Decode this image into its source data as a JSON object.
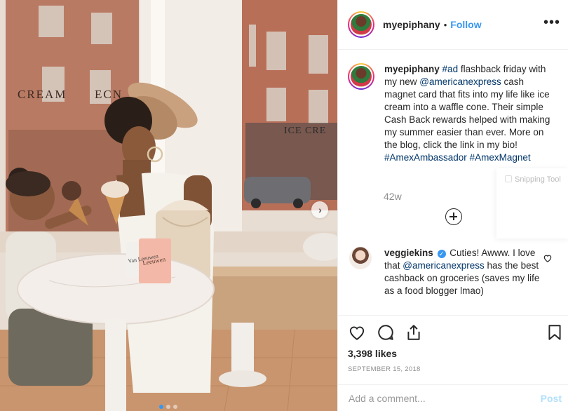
{
  "post": {
    "username": "myepiphany",
    "separator": "•",
    "follow_label": "Follow",
    "more_label": "•••",
    "caption": {
      "username": "myepiphany",
      "segments": [
        {
          "text": "#ad",
          "tag": true
        },
        {
          "text": " flashback friday with my new ",
          "tag": false
        },
        {
          "text": "@americanexpress",
          "tag": true
        },
        {
          "text": " cash magnet card that fits into my life like ice cream into a waffle cone. Their simple Cash Back rewards helped with making my summer easier than ever. More on the blog, click the link in my bio! ",
          "tag": false
        },
        {
          "text": "#AmexAmbassador",
          "tag": true
        },
        {
          "text": " ",
          "tag": false
        },
        {
          "text": "#AmexMagnet",
          "tag": true
        }
      ]
    },
    "age": "42w",
    "comments": [
      {
        "username": "veggiekins",
        "verified_mark": "✓",
        "segments": [
          {
            "text": " Cuties! Awww. I love that ",
            "tag": false
          },
          {
            "text": "@americanexpress",
            "tag": true
          },
          {
            "text": " has the best cashback on groceries (saves my life as a food blogger lmao)",
            "tag": false
          }
        ]
      }
    ],
    "likes": "3,398 likes",
    "date": "SEPTEMBER 15, 2018",
    "comment_placeholder": "Add a comment...",
    "post_label": "Post"
  },
  "photo": {
    "shop_sign_left": "CREAM",
    "shop_sign_left2": "ECN",
    "shop_sign_right": "ICE CRE",
    "cup1_text": "Van Leeuwen",
    "cup2_text": "Leeuwen",
    "carousel_next_glyph": "›",
    "slide_count": 3,
    "active_slide": 1
  },
  "overlay": {
    "snipping_label": "Snipping Tool"
  },
  "colors": {
    "link": "#3897f0",
    "tag": "#003569",
    "muted": "#8e8e8e",
    "border": "#efefef"
  }
}
